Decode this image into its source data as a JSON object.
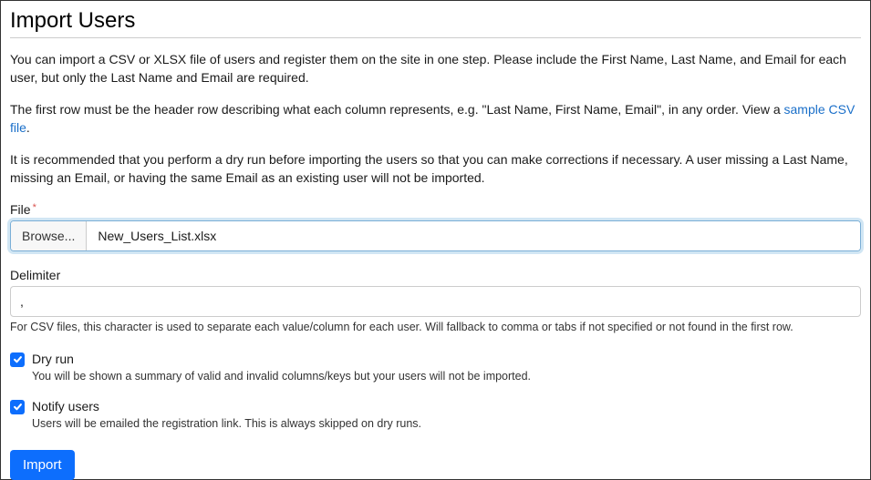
{
  "title": "Import Users",
  "intro": {
    "p1": "You can import a CSV or XLSX file of users and register them on the site in one step. Please include the First Name, Last Name, and Email for each user, but only the Last Name and Email are required.",
    "p2_prefix": "The first row must be the header row describing what each column represents, e.g. \"Last Name, First Name, Email\", in any order. View a ",
    "p2_link": "sample CSV file",
    "p2_suffix": ".",
    "p3": "It is recommended that you perform a dry run before importing the users so that you can make corrections if necessary. A user missing a Last Name, missing an Email, or having the same Email as an existing user will not be imported."
  },
  "file": {
    "label": "File",
    "browse": "Browse...",
    "value": "New_Users_List.xlsx"
  },
  "delimiter": {
    "label": "Delimiter",
    "value": ",",
    "help": "For CSV files, this character is used to separate each value/column for each user. Will fallback to comma or tabs if not specified or not found in the first row."
  },
  "dryrun": {
    "label": "Dry run",
    "help": "You will be shown a summary of valid and invalid columns/keys but your users will not be imported."
  },
  "notify": {
    "label": "Notify users",
    "help": "Users will be emailed the registration link. This is always skipped on dry runs."
  },
  "import_button": "Import"
}
